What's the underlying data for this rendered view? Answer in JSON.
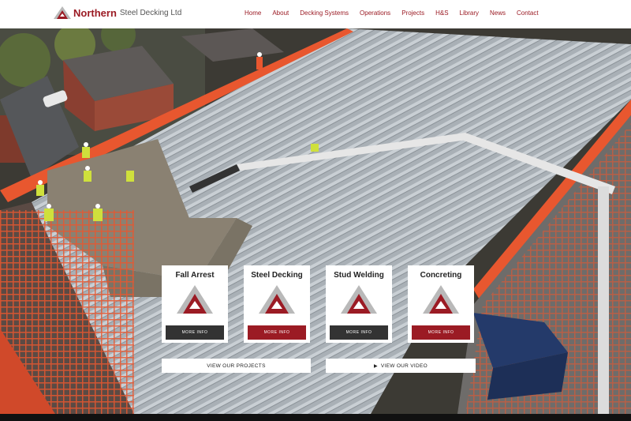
{
  "header": {
    "logo_name": "Northern",
    "logo_sub": "Steel Decking Ltd",
    "nav": [
      {
        "label": "Home"
      },
      {
        "label": "About"
      },
      {
        "label": "Decking Systems"
      },
      {
        "label": "Operations"
      },
      {
        "label": "Projects"
      },
      {
        "label": "H&S"
      },
      {
        "label": "Library"
      },
      {
        "label": "News"
      },
      {
        "label": "Contact"
      }
    ]
  },
  "cards": [
    {
      "title": "Fall Arrest",
      "button": "MORE INFO",
      "button_style": "dark"
    },
    {
      "title": "Steel Decking",
      "button": "MORE INFO",
      "button_style": "red"
    },
    {
      "title": "Stud Welding",
      "button": "MORE INFO",
      "button_style": "dark"
    },
    {
      "title": "Concreting",
      "button": "MORE INFO",
      "button_style": "red"
    }
  ],
  "actions": {
    "projects_label": "VIEW OUR PROJECTS",
    "video_label": "VIEW OUR VIDEO",
    "video_icon": "play-icon"
  },
  "colors": {
    "brand_red": "#9b1b24",
    "dark_button": "#333333",
    "logo_grey": "#b9b9b9"
  }
}
